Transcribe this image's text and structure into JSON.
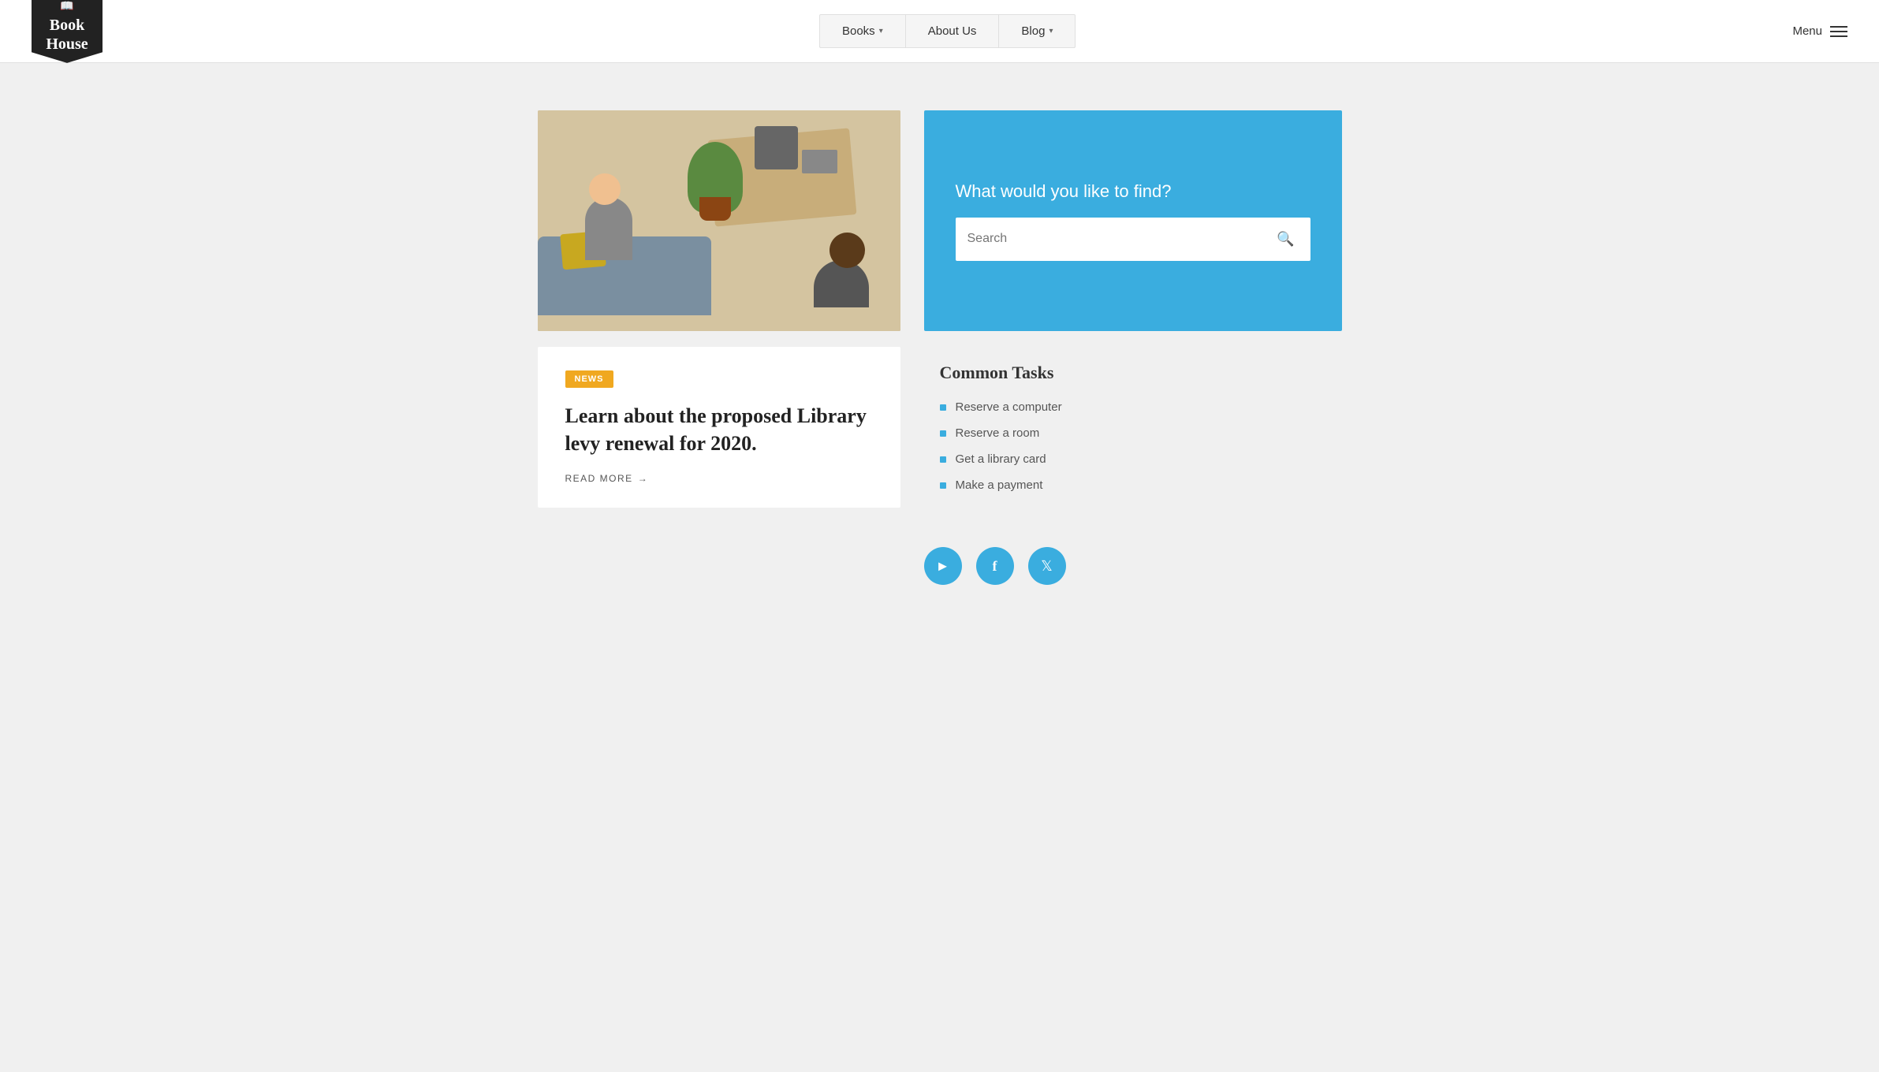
{
  "header": {
    "logo_line1": "Book",
    "logo_line2": "House",
    "logo_icon": "📖",
    "nav_items": [
      {
        "label": "Books",
        "has_chevron": true
      },
      {
        "label": "About Us",
        "has_chevron": false
      },
      {
        "label": "Blog",
        "has_chevron": true
      }
    ],
    "menu_label": "Menu"
  },
  "search": {
    "panel_title": "What would you like to find?",
    "placeholder": "Search",
    "button_icon": "🔍"
  },
  "news": {
    "badge": "NEWS",
    "title": "Learn about the proposed Library levy renewal for 2020.",
    "read_more": "READ MORE"
  },
  "common_tasks": {
    "title": "Common Tasks",
    "items": [
      {
        "label": "Reserve a computer"
      },
      {
        "label": "Reserve a room"
      },
      {
        "label": "Get a library card"
      },
      {
        "label": "Make a payment"
      }
    ]
  },
  "social": {
    "youtube_label": "YouTube",
    "facebook_label": "Facebook",
    "twitter_label": "Twitter"
  }
}
